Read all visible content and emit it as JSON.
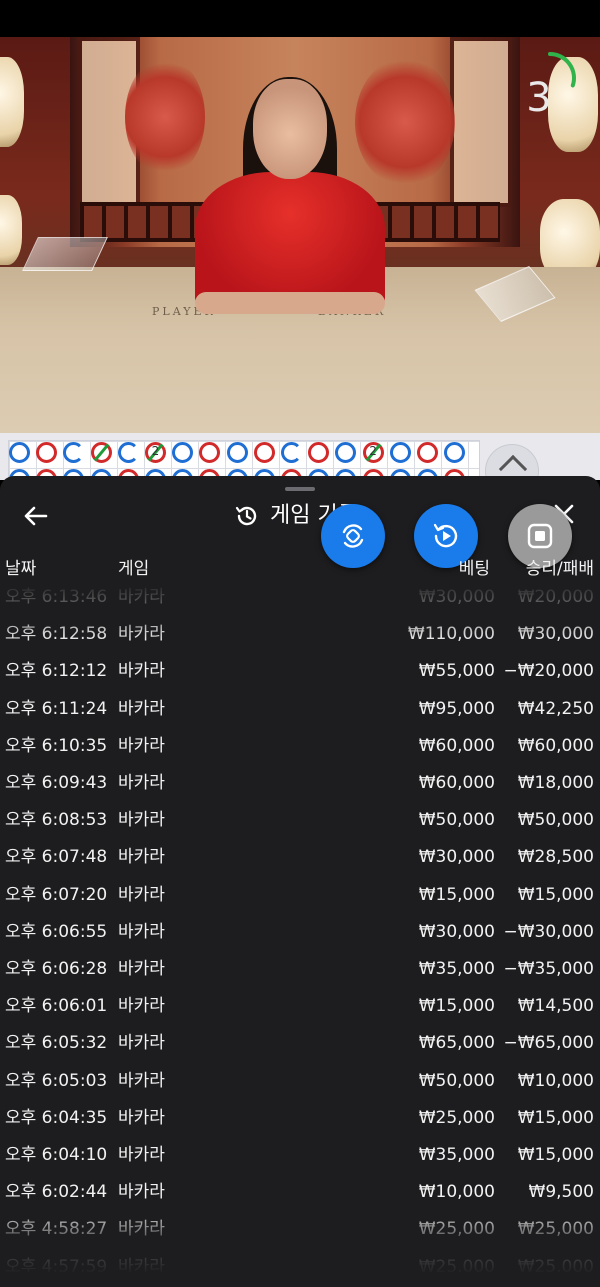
{
  "timer": {
    "seconds": "3",
    "progress_fraction": 0.3
  },
  "table_labels": {
    "player": "PLAYER",
    "banker": "BANKER"
  },
  "road": {
    "beads": [
      {
        "c": "b"
      },
      {
        "c": "r"
      },
      {
        "c": "b",
        "partial": true
      },
      {
        "c": "r",
        "slash": true
      },
      {
        "c": "b",
        "partial": true
      },
      {
        "c": "r",
        "slash": true,
        "num": "2"
      },
      {
        "c": "b"
      },
      {
        "c": "r"
      },
      {
        "c": "b"
      },
      {
        "c": "r"
      },
      {
        "c": "b",
        "partial": true
      },
      {
        "c": "r"
      },
      {
        "c": "b"
      },
      {
        "c": "r",
        "slash": true,
        "num": "2"
      },
      {
        "c": "b"
      },
      {
        "c": "r"
      },
      {
        "c": "b"
      }
    ]
  },
  "sheet": {
    "title": "게임 기록",
    "columns": {
      "date": "날짜",
      "game": "게임",
      "bet": "베팅",
      "result": "승리/패배"
    },
    "rows": [
      {
        "time": "오후 6:13:46",
        "game": "바카라",
        "bet": "₩30,000",
        "result": "₩20,000"
      },
      {
        "time": "오후 6:12:58",
        "game": "바카라",
        "bet": "₩110,000",
        "result": "₩30,000"
      },
      {
        "time": "오후 6:12:12",
        "game": "바카라",
        "bet": "₩55,000",
        "result": "−₩20,000"
      },
      {
        "time": "오후 6:11:24",
        "game": "바카라",
        "bet": "₩95,000",
        "result": "₩42,250"
      },
      {
        "time": "오후 6:10:35",
        "game": "바카라",
        "bet": "₩60,000",
        "result": "₩60,000"
      },
      {
        "time": "오후 6:09:43",
        "game": "바카라",
        "bet": "₩60,000",
        "result": "₩18,000"
      },
      {
        "time": "오후 6:08:53",
        "game": "바카라",
        "bet": "₩50,000",
        "result": "₩50,000"
      },
      {
        "time": "오후 6:07:48",
        "game": "바카라",
        "bet": "₩30,000",
        "result": "₩28,500"
      },
      {
        "time": "오후 6:07:20",
        "game": "바카라",
        "bet": "₩15,000",
        "result": "₩15,000"
      },
      {
        "time": "오후 6:06:55",
        "game": "바카라",
        "bet": "₩30,000",
        "result": "−₩30,000"
      },
      {
        "time": "오후 6:06:28",
        "game": "바카라",
        "bet": "₩35,000",
        "result": "−₩35,000"
      },
      {
        "time": "오후 6:06:01",
        "game": "바카라",
        "bet": "₩15,000",
        "result": "₩14,500"
      },
      {
        "time": "오후 6:05:32",
        "game": "바카라",
        "bet": "₩65,000",
        "result": "−₩65,000"
      },
      {
        "time": "오후 6:05:03",
        "game": "바카라",
        "bet": "₩50,000",
        "result": "₩10,000"
      },
      {
        "time": "오후 6:04:35",
        "game": "바카라",
        "bet": "₩25,000",
        "result": "₩15,000"
      },
      {
        "time": "오후 6:04:10",
        "game": "바카라",
        "bet": "₩35,000",
        "result": "₩15,000"
      },
      {
        "time": "오후 6:02:44",
        "game": "바카라",
        "bet": "₩10,000",
        "result": "₩9,500"
      },
      {
        "time": "오후 4:58:27",
        "game": "바카라",
        "bet": "₩25,000",
        "result": "₩25,000"
      },
      {
        "time": "오후 4:57:59",
        "game": "바카라",
        "bet": "₩25,000",
        "result": "₩25,000"
      }
    ]
  },
  "icons": {
    "back": "arrow-left-icon",
    "history": "history-icon",
    "close": "close-icon",
    "fab1": "rotate-link-icon",
    "fab2": "replay-play-icon",
    "fab3": "stop-record-icon",
    "expand": "chevron-up-icon"
  },
  "colors": {
    "sheet_bg": "#1d1d1f",
    "fab_blue": "#1a7bea",
    "fab_gray": "#9a9a9a",
    "banker_red": "#d22a2a",
    "player_blue": "#1f6ed4",
    "tie_green": "#1e9a3a",
    "timer_green": "#2fb34a"
  }
}
